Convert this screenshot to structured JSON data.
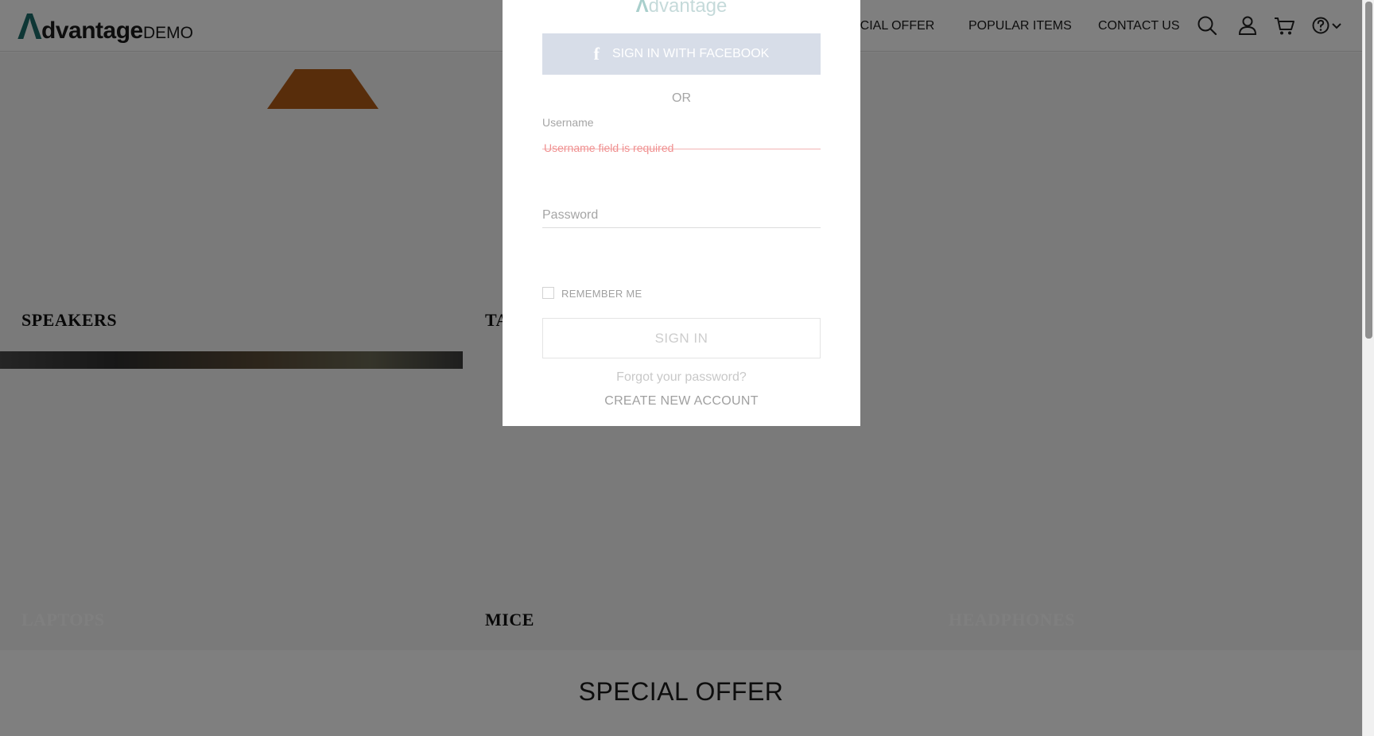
{
  "header": {
    "logo_mark": "Λ",
    "logo_brand": "dvantage",
    "logo_demo": "DEMO",
    "nav": {
      "special_offer": "ECIAL OFFER",
      "popular_items": "POPULAR ITEMS",
      "contact_us": "CONTACT US"
    },
    "icons": [
      "search-icon",
      "user-icon",
      "cart-icon",
      "help-icon",
      "chevron-down-icon"
    ]
  },
  "categories": {
    "speakers": "SPEAKERS",
    "tablets": "TA",
    "laptops": "LAPTOPS",
    "mice": "MICE",
    "headphones": "HEADPHONES"
  },
  "special_offer": {
    "title": "SPECIAL OFFER"
  },
  "login_modal": {
    "logo_mark": "Λ",
    "logo_text": "dvantage",
    "facebook_label": "SIGN IN WITH FACEBOOK",
    "or_label": "OR",
    "username_label": "Username",
    "username_value": "",
    "username_error": "Username field is required",
    "password_placeholder": "Password",
    "remember_me": "REMEMBER ME",
    "remember_checked": false,
    "sign_in": "SIGN IN",
    "forgot_password": "Forgot your password?",
    "create_account": "CREATE NEW ACCOUNT"
  },
  "colors": {
    "brand": "#1d6d6a",
    "overlay": "rgba(0,0,0,0.5)",
    "facebook_button": "#d7dde8",
    "error": "#f09090"
  }
}
